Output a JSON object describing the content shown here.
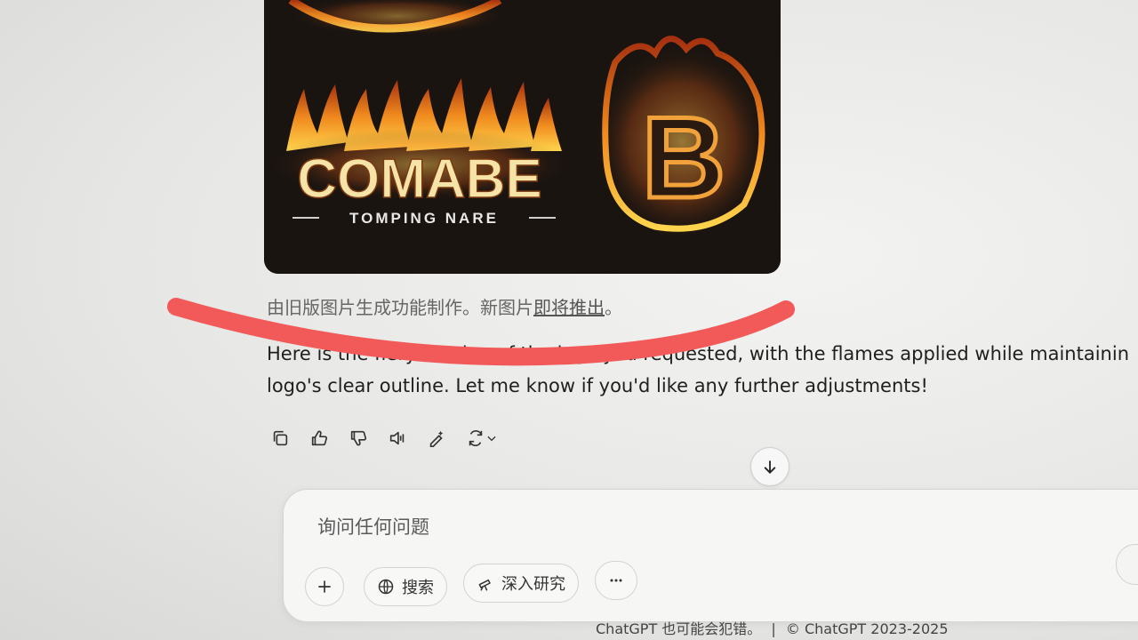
{
  "image": {
    "logo_text": "COMABE",
    "logo_subtitle": "TOMPING NARE",
    "monogram": "B"
  },
  "message": {
    "caption_prefix": "由旧版图片生成功能制作。新图片",
    "caption_link": "即将推出",
    "caption_suffix": "。",
    "reply_line1": "Here is the fiery version of the logo you requested, with the flames applied while maintainin",
    "reply_line2": "logo's clear outline. Let me know if you'd like any further adjustments!"
  },
  "actions": {
    "icons": [
      "copy-icon",
      "thumbs-up-icon",
      "thumbs-down-icon",
      "read-aloud-icon",
      "edit-icon",
      "regenerate-icon"
    ]
  },
  "composer": {
    "placeholder": "询问任何问题",
    "search_label": "搜索",
    "research_label": "深入研究"
  },
  "footer": {
    "disclaimer": "ChatGPT 也可能会犯错。",
    "separator": "|",
    "copyright": "ChatGPT 2023-2025"
  },
  "colors": {
    "annotation_stroke": "#f25a5a",
    "flame_orange": "#f08a1e",
    "image_bg": "#1a1410"
  }
}
